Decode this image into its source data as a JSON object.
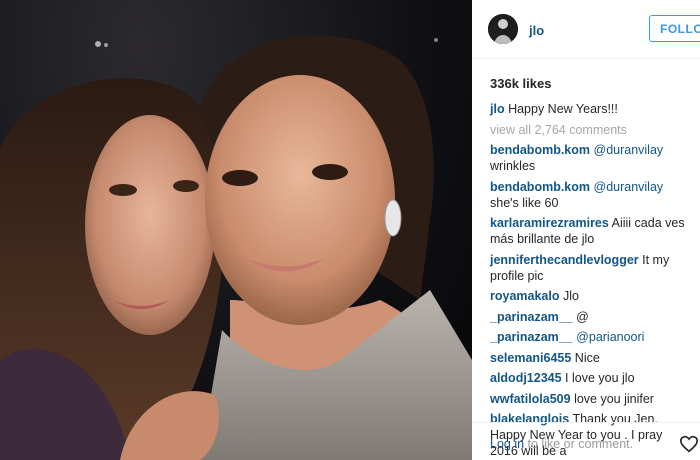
{
  "post": {
    "username": "jlo",
    "follow_label": "FOLLOW",
    "likes": "336k likes",
    "caption": {
      "author": "jlo",
      "text": "Happy New Years!!!"
    },
    "view_all": "view all 2,764 comments",
    "comments": [
      {
        "author": "bendabomb.kom",
        "mention": "@duranvilay",
        "text": " wrinkles"
      },
      {
        "author": "bendabomb.kom",
        "mention": "@duranvilay",
        "text": " she's like 60"
      },
      {
        "author": "karlaramirezramires",
        "mention": "",
        "text": " Aiiii cada ves más brillante de jlo"
      },
      {
        "author": "jenniferthecandlevlogger",
        "mention": "",
        "text": " It my profile pic"
      },
      {
        "author": "royamakalo",
        "mention": "",
        "text": " Jlo"
      },
      {
        "author": "_parinazam__",
        "mention": "",
        "text": " @"
      },
      {
        "author": "_parinazam__",
        "mention": "@parianoori",
        "text": ""
      },
      {
        "author": "selemani6455",
        "mention": "",
        "text": " Nice"
      },
      {
        "author": "aldodj12345",
        "mention": "",
        "text": " I love you jlo"
      },
      {
        "author": "wwfatilola509",
        "mention": "",
        "text": " love you jinifer"
      },
      {
        "author": "blakelanglois",
        "mention": "",
        "text": " Thank you Jen. Happy New Year to you . I pray 2016 will be a"
      }
    ],
    "footer": {
      "login_link": "Log in",
      "login_rest": " to like or comment."
    },
    "icons": {
      "avatar": "profile-avatar-icon",
      "like": "heart-icon"
    },
    "colors": {
      "link": "#125688",
      "follow": "#3897f0",
      "muted": "#a5a7aa"
    }
  }
}
